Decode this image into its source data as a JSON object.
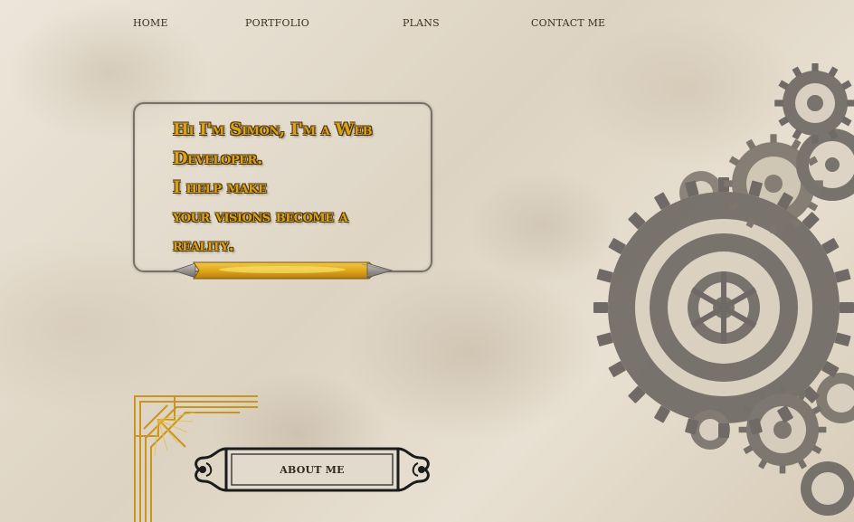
{
  "nav": {
    "items": [
      {
        "label": "HOME"
      },
      {
        "label": "PORTFOLIO"
      },
      {
        "label": "PLANS"
      },
      {
        "label": "CONTACT ME"
      }
    ]
  },
  "hero": {
    "lines": [
      "Hi I'm Simon, I'm a Web",
      "Developer.",
      "I help make",
      "your visions become a",
      "reality."
    ]
  },
  "about": {
    "label": "ABOUT ME"
  },
  "icons": {
    "pencil": "pencil-icon",
    "gears": "gears-illustration",
    "corner": "art-deco-corner-ornament",
    "frame": "ornate-frame"
  },
  "colors": {
    "accent_gold": "#d9a21c",
    "text_dark": "#3e2e22",
    "gear_gray": "#6f6a65"
  }
}
